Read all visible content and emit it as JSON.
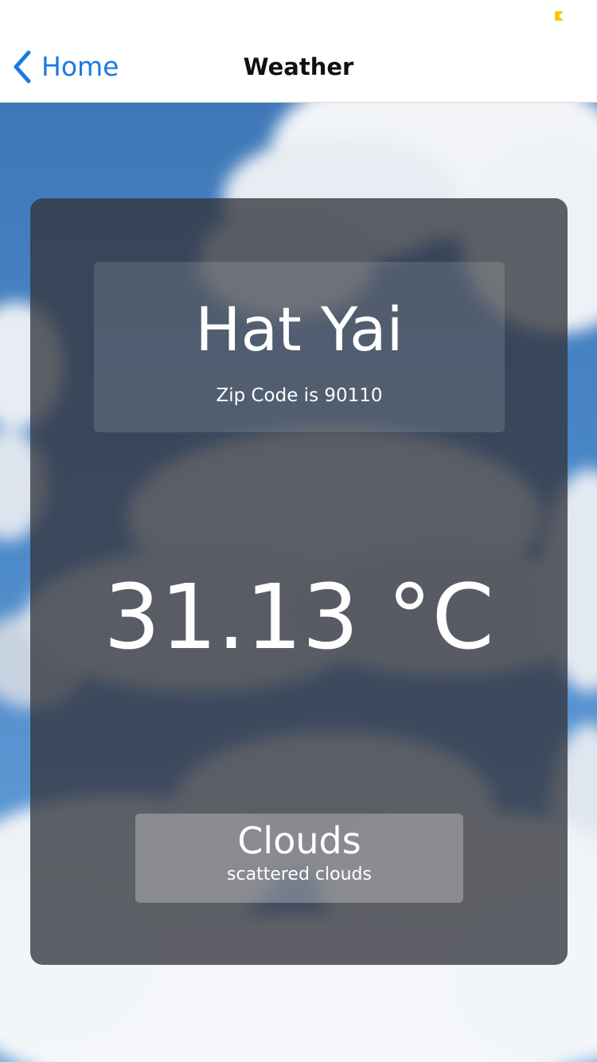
{
  "status_bar": {
    "battery_icon": "battery-low-icon",
    "battery_color": "#f5cc00"
  },
  "nav": {
    "back_icon": "chevron-left-icon",
    "back_label": "Home",
    "title": "Weather",
    "accent_color": "#1a7ae0"
  },
  "weather": {
    "city": "Hat Yai",
    "zip_text": "Zip Code is 90110",
    "temperature": "31.13 °C",
    "condition": "Clouds",
    "description": "scattered clouds"
  },
  "background": {
    "image": "cloudy-sky-image"
  }
}
